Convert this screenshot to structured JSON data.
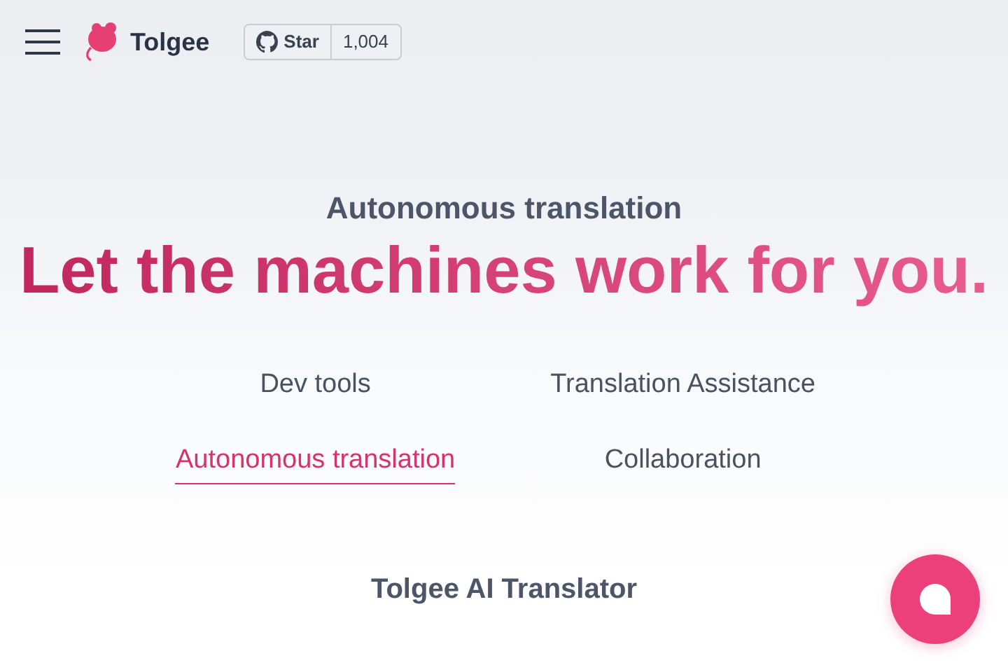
{
  "header": {
    "logo_text": "Tolgee",
    "github": {
      "label": "Star",
      "count": "1,004"
    }
  },
  "hero": {
    "eyebrow": "Autonomous translation",
    "headline": "Let the machines work for you."
  },
  "tabs": [
    {
      "label": "Dev tools",
      "selected": false
    },
    {
      "label": "Translation Assistance",
      "selected": false
    },
    {
      "label": "Autonomous translation",
      "selected": true
    },
    {
      "label": "Collaboration",
      "selected": false
    }
  ],
  "section_title": "Tolgee AI Translator"
}
